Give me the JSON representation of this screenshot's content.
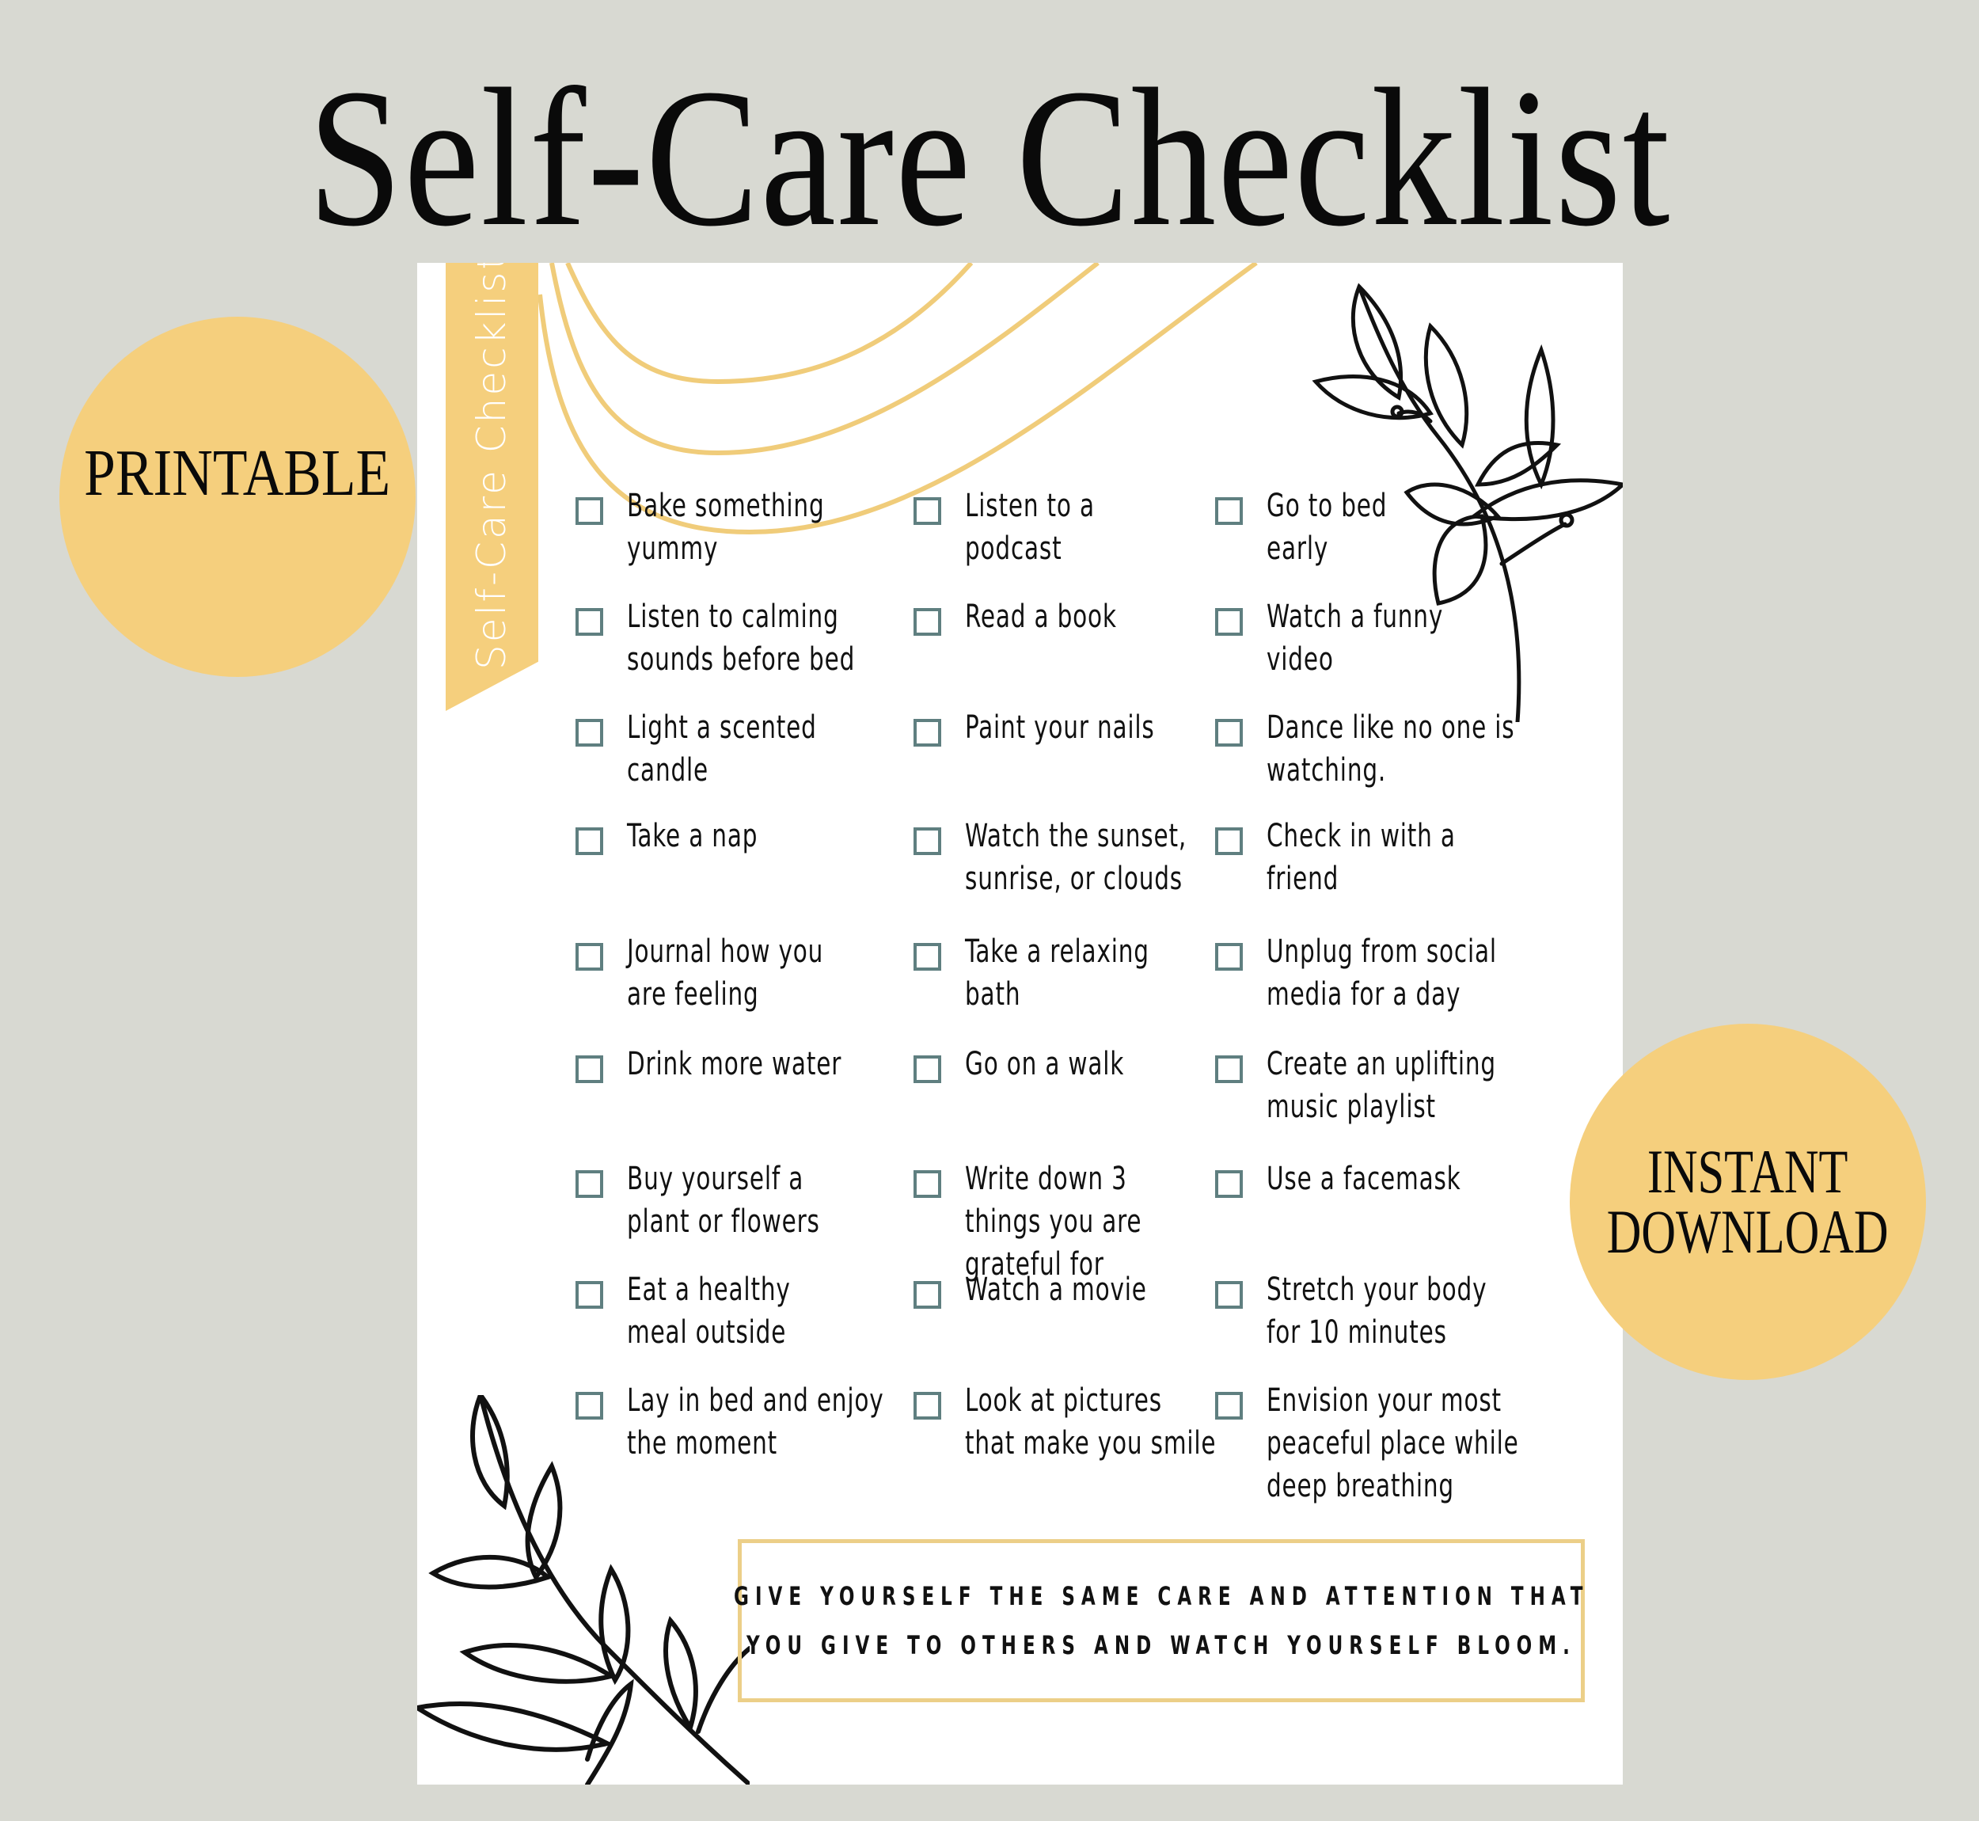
{
  "header": {
    "title": "Self-Care Checklist"
  },
  "badges": {
    "printable": "PRINTABLE",
    "instant_line1": "INSTANT",
    "instant_line2": "DOWNLOAD"
  },
  "colors": {
    "background": "#d8d9d2",
    "accent_yellow": "#f5cf7d",
    "checkbox": "#5f7f80",
    "quote_border": "#eccf88"
  },
  "sheet": {
    "ribbon_title": "Self-Care Checklist",
    "columns": [
      {
        "items": [
          "Bake something\nyummy",
          "Listen to calming\nsounds before bed",
          "Light a scented\ncandle",
          "Take a nap",
          "Journal how you\nare feeling",
          "Drink more water",
          "Buy yourself a\nplant or flowers",
          "Eat a healthy\nmeal outside",
          "Lay in bed and enjoy\nthe moment"
        ]
      },
      {
        "items": [
          "Listen to a\npodcast",
          "Read a book",
          "Paint your nails",
          "Watch the sunset,\nsunrise, or clouds",
          "Take a relaxing\nbath",
          "Go on a walk",
          "Write down 3\nthings you are\ngrateful for",
          "Watch a movie",
          "Look at pictures\nthat make you smile"
        ]
      },
      {
        "items": [
          "Go to bed\nearly",
          "Watch a funny\nvideo",
          "Dance like no one is\nwatching.",
          "Check in with a\nfriend",
          "Unplug from social\nmedia for a day",
          "Create an uplifting\nmusic playlist",
          "Use a facemask",
          "Stretch your body\nfor 10 minutes",
          "Envision  your most\npeaceful place while\ndeep breathing"
        ]
      }
    ],
    "quote": {
      "line1": "GIVE YOURSELF THE SAME CARE AND ATTENTION THAT",
      "line2": "YOU GIVE TO OTHERS AND WATCH YOURSELF BLOOM."
    }
  }
}
